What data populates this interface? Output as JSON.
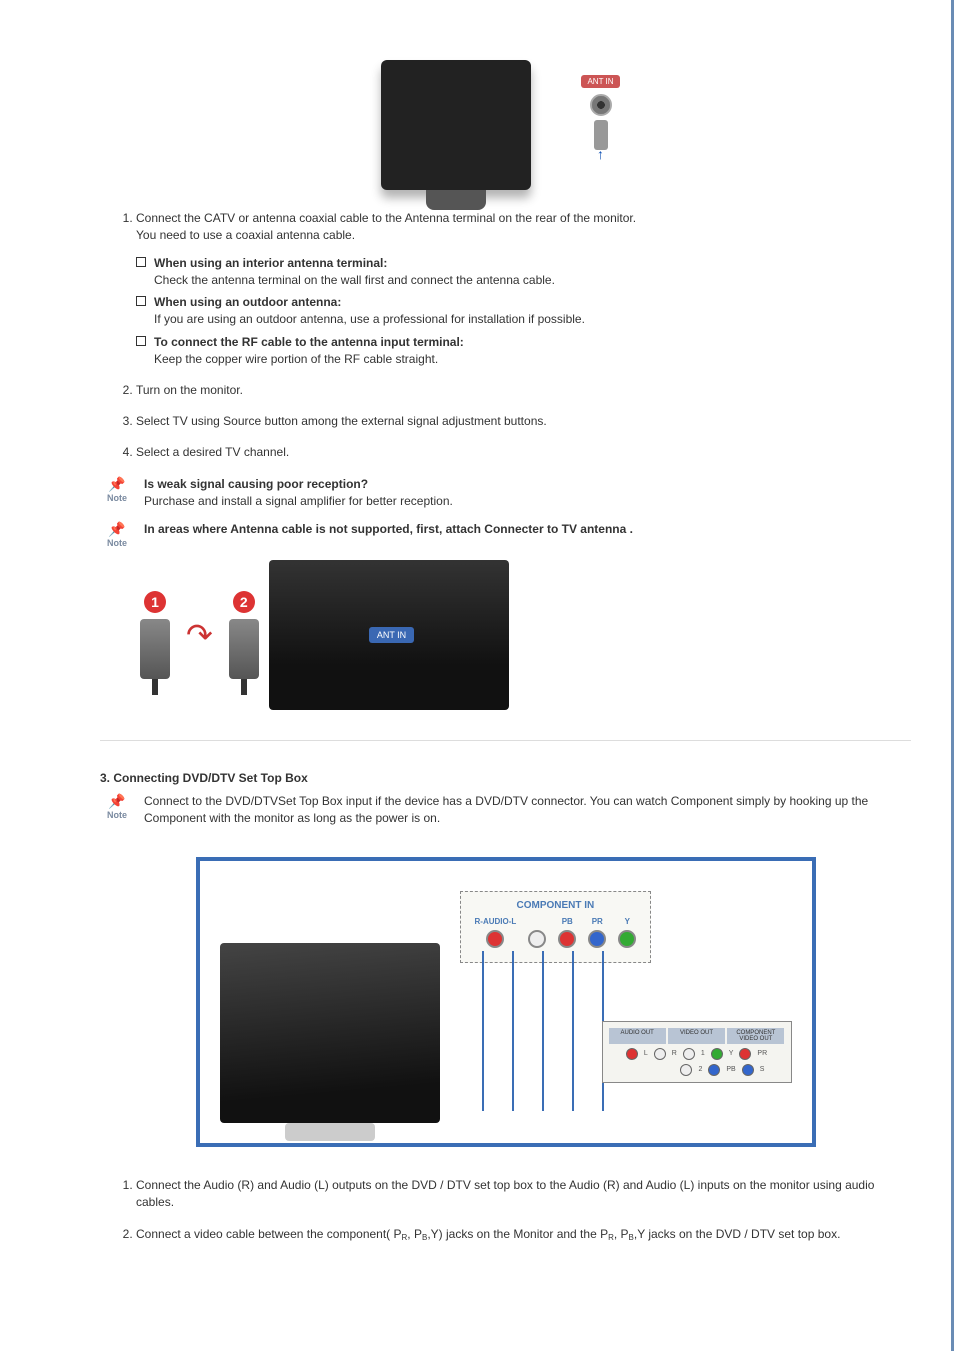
{
  "fig1": {
    "ant_label": "ANT IN"
  },
  "list1": {
    "step1_a": "Connect the CATV or antenna coaxial cable to the Antenna terminal on the rear of the monitor.",
    "step1_b": "You need to use a coaxial antenna cable.",
    "sub1_head": "When using an interior antenna terminal:",
    "sub1_body": "Check the antenna terminal on the wall first and connect the antenna cable.",
    "sub2_head": "When using an outdoor antenna:",
    "sub2_body": "If you are using an outdoor antenna, use a professional for installation if possible.",
    "sub3_head": "To connect the RF cable to the antenna input terminal:",
    "sub3_body": "Keep the copper wire portion of the RF cable straight.",
    "step2": "Turn on the monitor.",
    "step3": "Select TV using Source button among the external signal adjustment buttons.",
    "step4": "Select a desired TV channel."
  },
  "note": {
    "label": "Note"
  },
  "note1_head": "Is weak signal causing poor reception?",
  "note1_body": "Purchase and install a signal amplifier for better reception.",
  "note2_head": "In areas where Antenna cable is not supported, first, attach Connecter to TV antenna .",
  "fig2": {
    "marker1": "1",
    "marker2": "2",
    "antin": "ANT IN"
  },
  "section3": {
    "title": "3. Connecting DVD/DTV Set Top Box",
    "note_body": "Connect to the DVD/DTVSet Top Box input if the device has a DVD/DTV connector. You can watch Component simply by hooking up the Component with the monitor as long as the power is on."
  },
  "comp": {
    "title": "COMPONENT IN",
    "raudio": "R-AUDIO-L",
    "pb": "PB",
    "pr": "PR",
    "y": "Y",
    "stbox_tabs": [
      "AUDIO OUT",
      "VIDEO OUT",
      "COMPONENT VIDEO OUT"
    ],
    "stbox_l": "L",
    "stbox_r": "R",
    "stbox_y": "Y",
    "stbox_pb": "PB",
    "stbox_pr": "PR",
    "stbox_s": "S",
    "c1": "1",
    "c2": "2"
  },
  "list2": {
    "step1": "Connect the Audio (R) and Audio (L) outputs on the DVD / DTV set top box to the Audio (R) and Audio (L) inputs on the monitor using audio cables.",
    "step2_a": "Connect a video cable between the component( P",
    "step2_b": ", P",
    "step2_c": ",Y) jacks on the Monitor and the P",
    "step2_d": ", P",
    "step2_e": ",Y jacks on the DVD / DTV set top box.",
    "sub_r": "R",
    "sub_b": "B"
  }
}
